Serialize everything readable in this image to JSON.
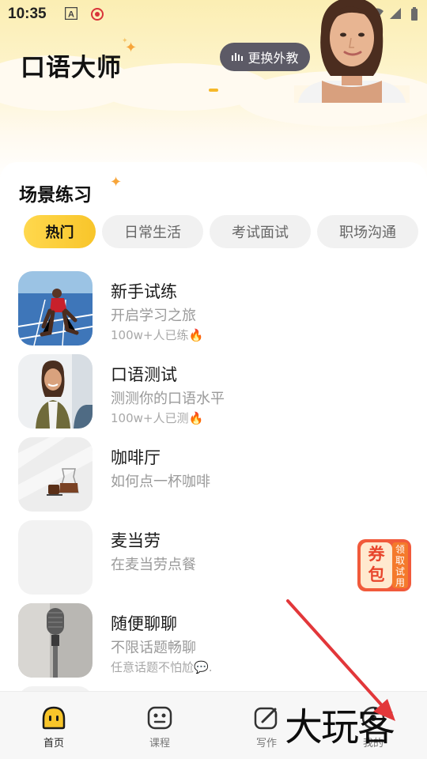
{
  "status_bar": {
    "time": "10:35"
  },
  "header": {
    "title": "口语大师",
    "switch_teacher_label": "更换外教"
  },
  "scene_section": {
    "title": "场景练习",
    "tabs": [
      "热门",
      "日常生活",
      "考试面试",
      "职场沟通"
    ],
    "active_tab": "热门"
  },
  "items": [
    {
      "title": "新手试练",
      "subtitle": "开启学习之旅",
      "extra": "100w+人已练",
      "extra_icon": "fire-icon"
    },
    {
      "title": "口语测试",
      "subtitle": "测测你的口语水平",
      "extra": "100w+人已测",
      "extra_icon": "fire-icon"
    },
    {
      "title": "咖啡厅",
      "subtitle": "如何点一杯咖啡"
    },
    {
      "title": "麦当劳",
      "subtitle": "在麦当劳点餐"
    },
    {
      "title": "随便聊聊",
      "subtitle": "不限话题畅聊",
      "extra": "任意话题不怕尬",
      "extra_icon": "chat-bubble-icon"
    }
  ],
  "coupon": {
    "main": "券包",
    "side": "领取试用"
  },
  "nav": [
    {
      "label": "首页",
      "icon": "home-face-icon",
      "active": true
    },
    {
      "label": "课程",
      "icon": "course-icon"
    },
    {
      "label": "写作",
      "icon": "write-icon"
    },
    {
      "label": "我的",
      "icon": "profile-icon"
    }
  ],
  "watermark": "大玩客",
  "colors": {
    "accent": "#f8c52a",
    "button_dark": "#5c5a66",
    "arrow": "#e2373a"
  }
}
